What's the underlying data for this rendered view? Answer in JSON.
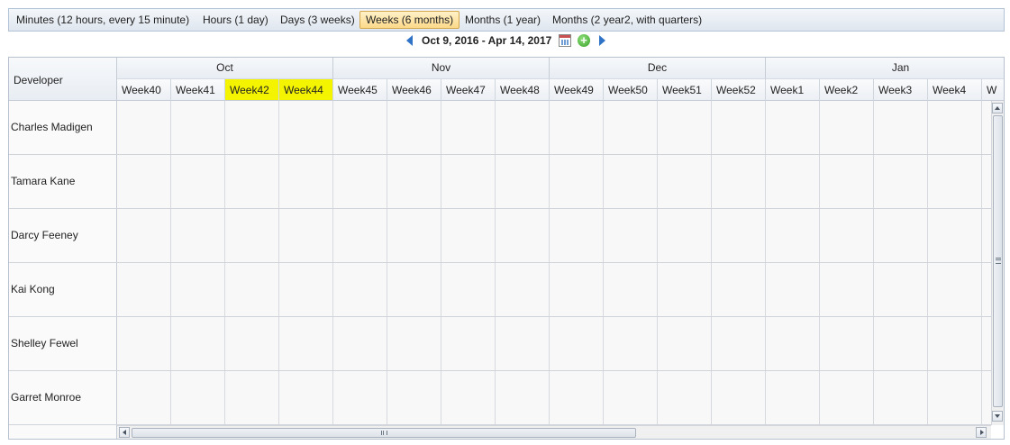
{
  "toolbar": {
    "buttons": [
      {
        "label": "Minutes (12 hours, every 15 minute)"
      },
      {
        "label": "Hours (1 day)"
      },
      {
        "label": "Days (3 weeks)"
      },
      {
        "label": "Weeks (6 months)",
        "active": true
      },
      {
        "label": "Months (1 year)"
      },
      {
        "label": "Months (2 year2, with quarters)"
      }
    ]
  },
  "navigator": {
    "range": "Oct 9, 2016 - Apr 14, 2017",
    "icons": [
      "arrow-left-icon",
      "calendar-icon",
      "add-icon",
      "arrow-right-icon"
    ]
  },
  "grid": {
    "resource_header": "Developer",
    "months": [
      {
        "label": "Oct",
        "weeks": 4
      },
      {
        "label": "Nov",
        "weeks": 4
      },
      {
        "label": "Dec",
        "weeks": 4
      },
      {
        "label": "Jan",
        "weeks": 5
      }
    ],
    "weeks": [
      {
        "label": "Week40"
      },
      {
        "label": "Week41"
      },
      {
        "label": "Week42",
        "highlighted": true
      },
      {
        "label": "Week44",
        "highlighted": true
      },
      {
        "label": "Week45"
      },
      {
        "label": "Week46"
      },
      {
        "label": "Week47"
      },
      {
        "label": "Week48"
      },
      {
        "label": "Week49"
      },
      {
        "label": "Week50"
      },
      {
        "label": "Week51"
      },
      {
        "label": "Week52"
      },
      {
        "label": "Week1"
      },
      {
        "label": "Week2"
      },
      {
        "label": "Week3"
      },
      {
        "label": "Week4"
      },
      {
        "label": "W"
      }
    ],
    "highlight_color": "#f4f400",
    "developers": [
      {
        "name": "Charles Madigen"
      },
      {
        "name": "Tamara Kane"
      },
      {
        "name": "Darcy Feeney"
      },
      {
        "name": "Kai Kong"
      },
      {
        "name": "Shelley Fewel"
      },
      {
        "name": "Garret Monroe"
      }
    ]
  },
  "colors": {
    "active_tab": "#fcd98a",
    "nav_arrow": "#2f73c7",
    "highlight": "#f4f400"
  }
}
